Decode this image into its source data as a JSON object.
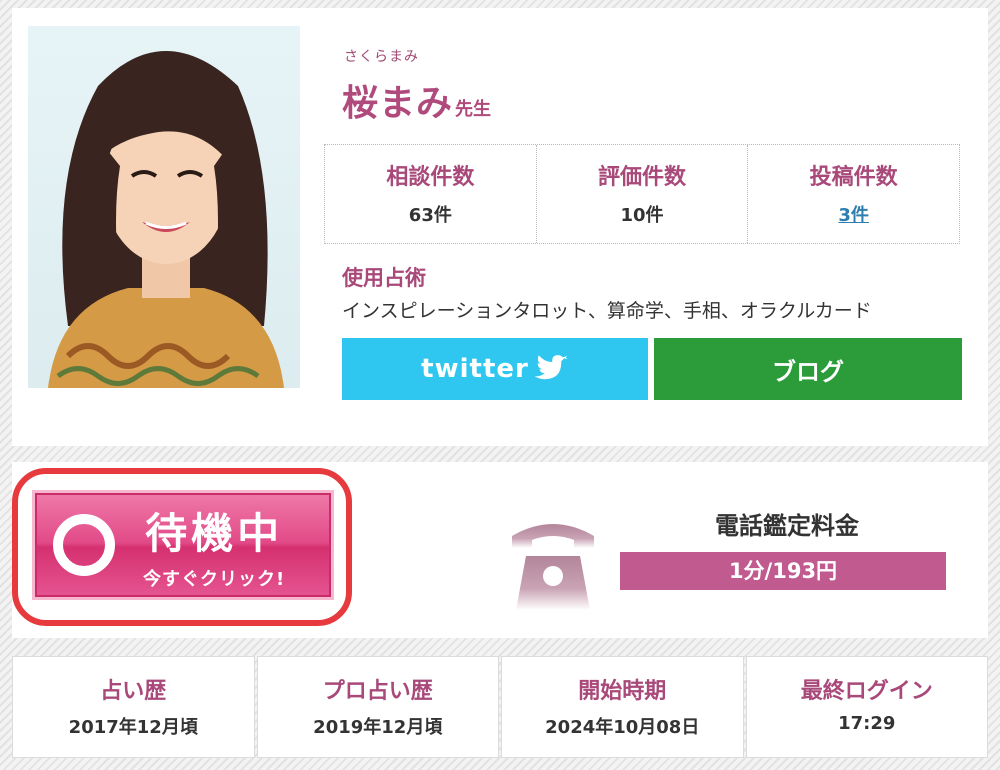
{
  "profile": {
    "reading": "さくらまみ",
    "name": "桜まみ",
    "honorific": "先生",
    "stats": [
      {
        "label": "相談件数",
        "value": "63件"
      },
      {
        "label": "評価件数",
        "value": "10件"
      },
      {
        "label": "投稿件数",
        "value": "3件"
      }
    ],
    "methods_label": "使用占術",
    "methods": "インスピレーションタロット、算命学、手相、オラクルカード",
    "twitter_label": "twitter",
    "blog_label": "ブログ"
  },
  "action": {
    "status_main": "待機中",
    "status_sub": "今すぐクリック!",
    "fee_title": "電話鑑定料金",
    "fee_value": "1分/193円"
  },
  "history": [
    {
      "label": "占い歴",
      "value": "2017年12月頃"
    },
    {
      "label": "プロ占い歴",
      "value": "2019年12月頃"
    },
    {
      "label": "開始時期",
      "value": "2024年10月08日"
    },
    {
      "label": "最終ログイン",
      "value": "17:29"
    }
  ],
  "colors": {
    "accent": "#a8497a",
    "twitter": "#2fc7ef",
    "blog": "#2b9c39",
    "fee_bar": "#c05a8f",
    "highlight_outline": "#e63a3e"
  },
  "icons": {
    "twitter": "bird-icon",
    "phone": "telephone-icon",
    "status": "ring-icon"
  }
}
